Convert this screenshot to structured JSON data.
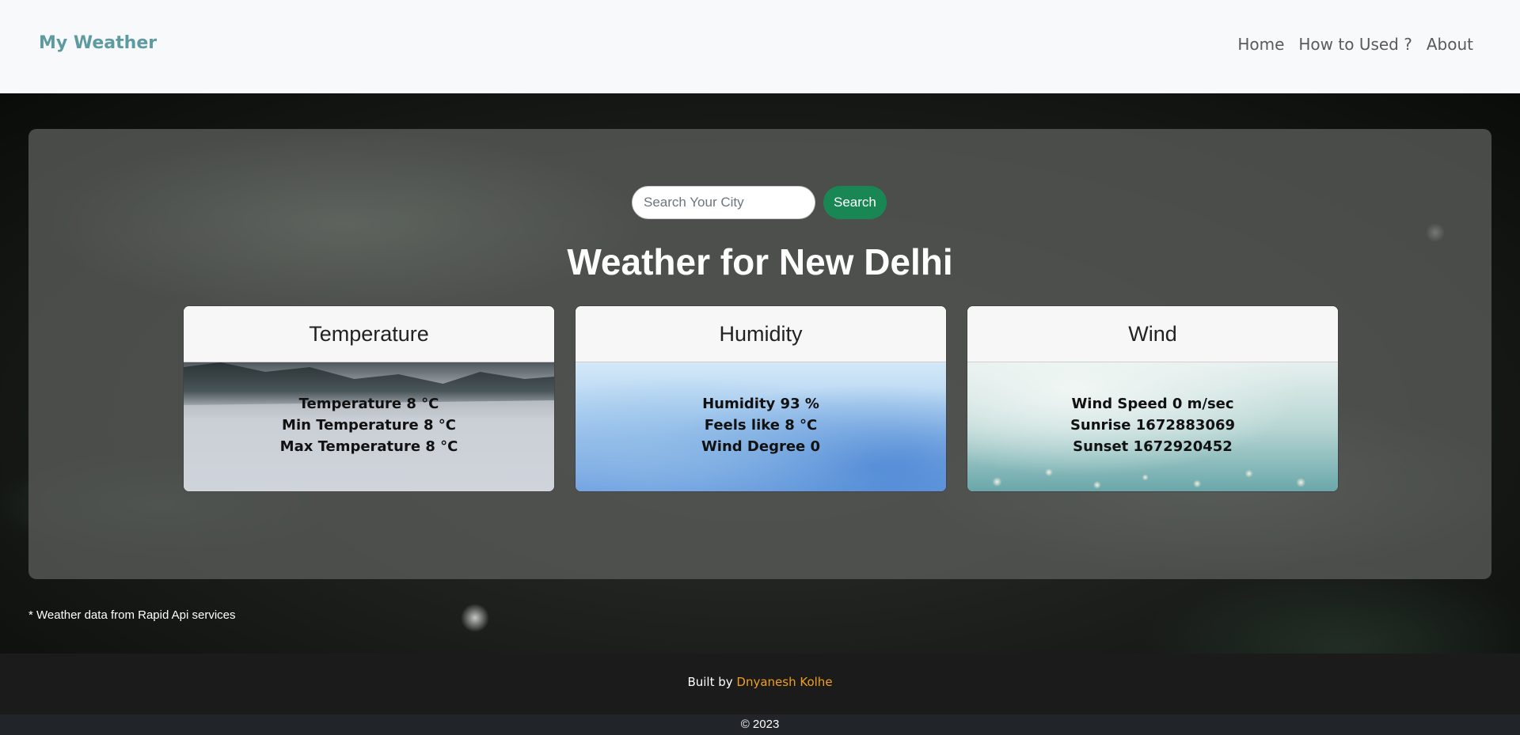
{
  "navbar": {
    "brand": "My Weather",
    "links": [
      "Home",
      "How to Used ?",
      "About"
    ]
  },
  "search": {
    "placeholder": "Search Your City",
    "button_label": "Search"
  },
  "main": {
    "title": "Weather for New Delhi"
  },
  "cards": {
    "temperature": {
      "header": "Temperature",
      "lines": [
        "Temperature 8 °C",
        "Min Temperature 8 °C",
        "Max Temperature 8 °C"
      ]
    },
    "humidity": {
      "header": "Humidity",
      "lines": [
        "Humidity 93 %",
        "Feels like 8 °C",
        "Wind Degree 0"
      ]
    },
    "wind": {
      "header": "Wind",
      "lines": [
        "Wind Speed 0 m/sec",
        "Sunrise 1672883069",
        "Sunset 1672920452"
      ]
    }
  },
  "footnote": "* Weather data from Rapid Api services",
  "footer": {
    "built_by": "Built by",
    "author": "Dnyanesh Kolhe",
    "copyright": "© 2023"
  },
  "colors": {
    "brand": "#5e9ba0",
    "search_button": "#198754",
    "author_link": "#f0a020"
  }
}
